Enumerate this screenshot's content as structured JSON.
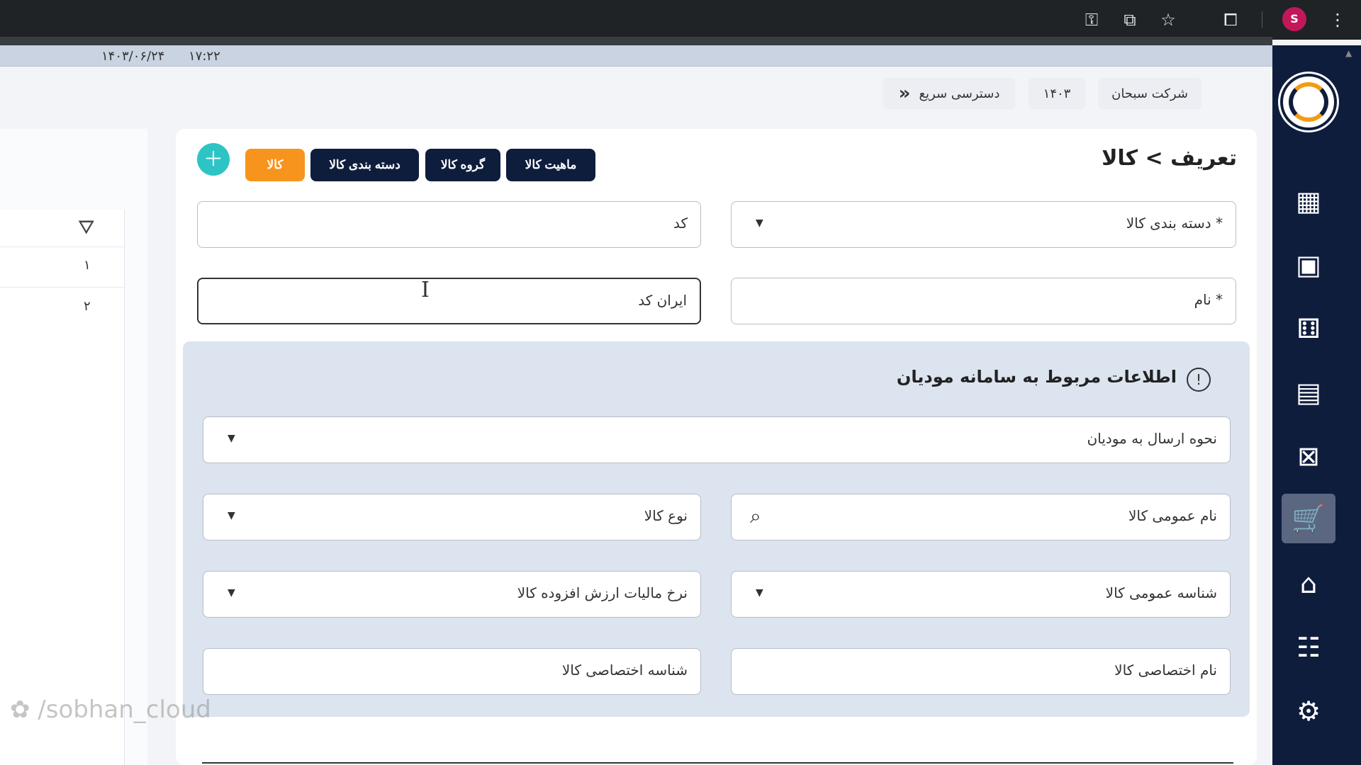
{
  "datetime": {
    "date": "۱۴۰۳/۰۶/۲۴",
    "time": "۱۷:۲۲"
  },
  "browser": {
    "profile_initial": "S"
  },
  "header": {
    "company": "شرکت سبحان",
    "year": "۱۴۰۳",
    "quick_access": "دسترسی سریع"
  },
  "page": {
    "title": "تعریف > کالا"
  },
  "nav_buttons": {
    "nature": "ماهیت کالا",
    "group": "گروه کالا",
    "category": "دسته بندی کالا",
    "item": "کالا"
  },
  "form": {
    "category_label": "* دسته بندی کالا",
    "code_label": "کد",
    "name_label": "* نام",
    "iran_code_label": "ایران کد"
  },
  "tax_section": {
    "title": "اطلاعات مربوط به سامانه مودیان",
    "send_method": "نحوه ارسال به مودیان",
    "general_name": "نام عمومی کالا",
    "item_type": "نوع کالا",
    "general_id": "شناسه عمومی کالا",
    "vat_rate": "نرخ مالیات ارزش افزوده کالا",
    "private_name": "نام اختصاصی کالا",
    "private_id": "شناسه اختصاصی کالا"
  },
  "left_table": {
    "rows": [
      "۱",
      "۲"
    ]
  },
  "watermark": "/sobhan_cloud",
  "colors": {
    "primary": "#0f1d3d",
    "accent": "#f7941d",
    "add": "#2ec4c6",
    "tax_bg": "#dbe4ef"
  }
}
